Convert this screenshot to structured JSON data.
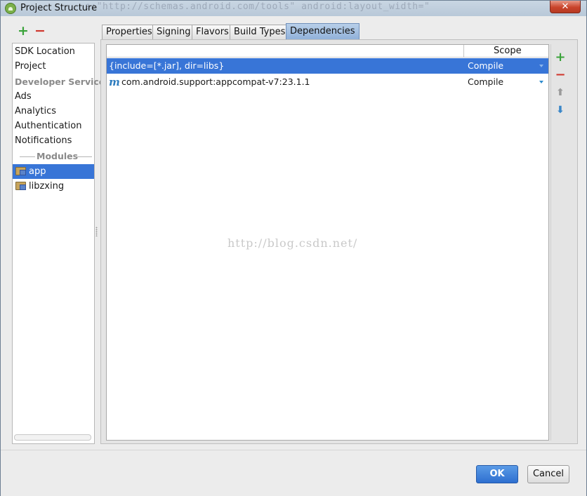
{
  "window": {
    "title": "Project Structure",
    "close_glyph": "✕",
    "background_code": "s:\"http://schemas.android.com/tools\"  android:layout_width=\""
  },
  "left_toolbar": {
    "add_icon": "+",
    "remove_icon": "−"
  },
  "sidebar": {
    "items": [
      {
        "label": "SDK Location"
      },
      {
        "label": "Project"
      }
    ],
    "group_header": "Developer Services",
    "services": [
      {
        "label": "Ads"
      },
      {
        "label": "Analytics"
      },
      {
        "label": "Authentication"
      },
      {
        "label": "Notifications"
      }
    ],
    "modules_header": "Modules",
    "modules": [
      {
        "label": "app",
        "selected": true
      },
      {
        "label": "libzxing",
        "selected": false
      }
    ]
  },
  "tabs": [
    {
      "label": "Properties"
    },
    {
      "label": "Signing"
    },
    {
      "label": "Flavors"
    },
    {
      "label": "Build Types"
    },
    {
      "label": "Dependencies",
      "active": true
    }
  ],
  "dependencies": {
    "column_scope": "Scope",
    "rows": [
      {
        "name": "{include=[*.jar], dir=libs}",
        "scope": "Compile",
        "selected": true,
        "maven_icon": false
      },
      {
        "name": "com.android.support:appcompat-v7:23.1.1",
        "scope": "Compile",
        "selected": false,
        "maven_icon": true
      }
    ],
    "maven_icon_glyph": "m"
  },
  "right_toolbar": {
    "add_icon": "+",
    "remove_icon": "−",
    "move_up_icon": "⬆",
    "move_down_icon": "⬇"
  },
  "watermark": "http://blog.csdn.net/",
  "footer": {
    "ok_label": "OK",
    "cancel_label": "Cancel"
  },
  "colors": {
    "selection": "#3875d7",
    "ok_button": "#2e6fd0",
    "add": "#3aa33a",
    "remove": "#d0382f"
  }
}
